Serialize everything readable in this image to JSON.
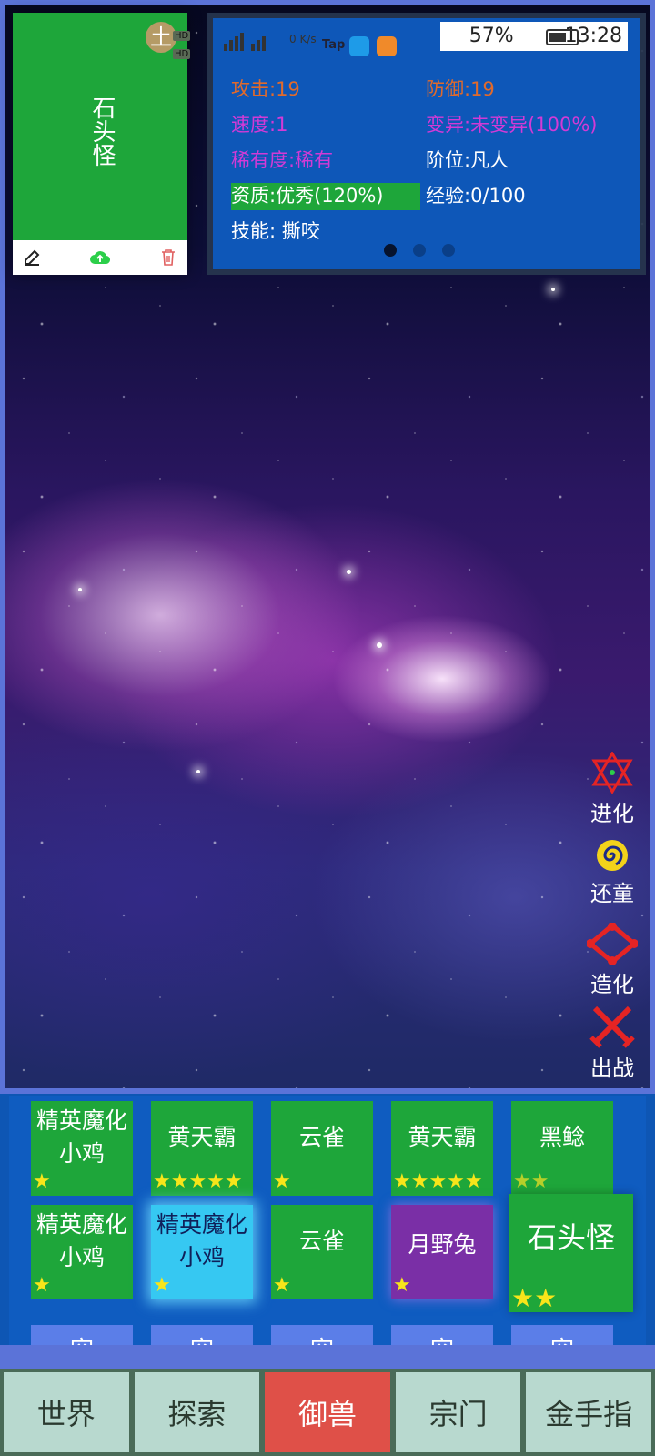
{
  "status_bar": {
    "avatar_char": "土",
    "hd1": "HD",
    "hd2": "HD",
    "net": "0 K/s",
    "tap": "Tap",
    "battery": "57%",
    "time": "13:28"
  },
  "pet_card": {
    "name": "石头怪",
    "icons": [
      "edit-icon",
      "cloud-upload-icon",
      "trash-icon"
    ]
  },
  "info": {
    "attack": "攻击:19",
    "defense": "防御:19",
    "speed": "速度:1",
    "mutation": "变异:未变异(100%)",
    "rarity": "稀有度:稀有",
    "rank": "阶位:凡人",
    "quality": "资质:优秀(120%)",
    "exp": "经验:0/100",
    "skill": "技能: 撕咬"
  },
  "actions": [
    {
      "label": "进化",
      "icon": "hexagram-icon",
      "color": "#e52424"
    },
    {
      "label": "还童",
      "icon": "swirl-icon",
      "color": "#f2d21a"
    },
    {
      "label": "造化",
      "icon": "diamond-ring-icon",
      "color": "#e52424"
    },
    {
      "label": "出战",
      "icon": "crossed-swords-icon",
      "color": "#e52424"
    }
  ],
  "pets": [
    {
      "name": "精英魔化小鸡",
      "stars": 1
    },
    {
      "name": "黄天霸",
      "stars": 5
    },
    {
      "name": "云雀",
      "stars": 1
    },
    {
      "name": "黄天霸",
      "stars": 5
    },
    {
      "name": "黑鲶",
      "stars": 2
    },
    {
      "name": "精英魔化小鸡",
      "stars": 1
    },
    {
      "name": "精英魔化小鸡",
      "stars": 1
    },
    {
      "name": "云雀",
      "stars": 1
    },
    {
      "name": "月野兔",
      "stars": 1
    },
    {
      "name": "石头怪",
      "stars": 2
    }
  ],
  "empty_slot_char": "空",
  "nav": [
    {
      "label": "世界",
      "active": false
    },
    {
      "label": "探索",
      "active": false
    },
    {
      "label": "御兽",
      "active": true
    },
    {
      "label": "宗门",
      "active": false
    },
    {
      "label": "金手指",
      "active": false
    }
  ]
}
